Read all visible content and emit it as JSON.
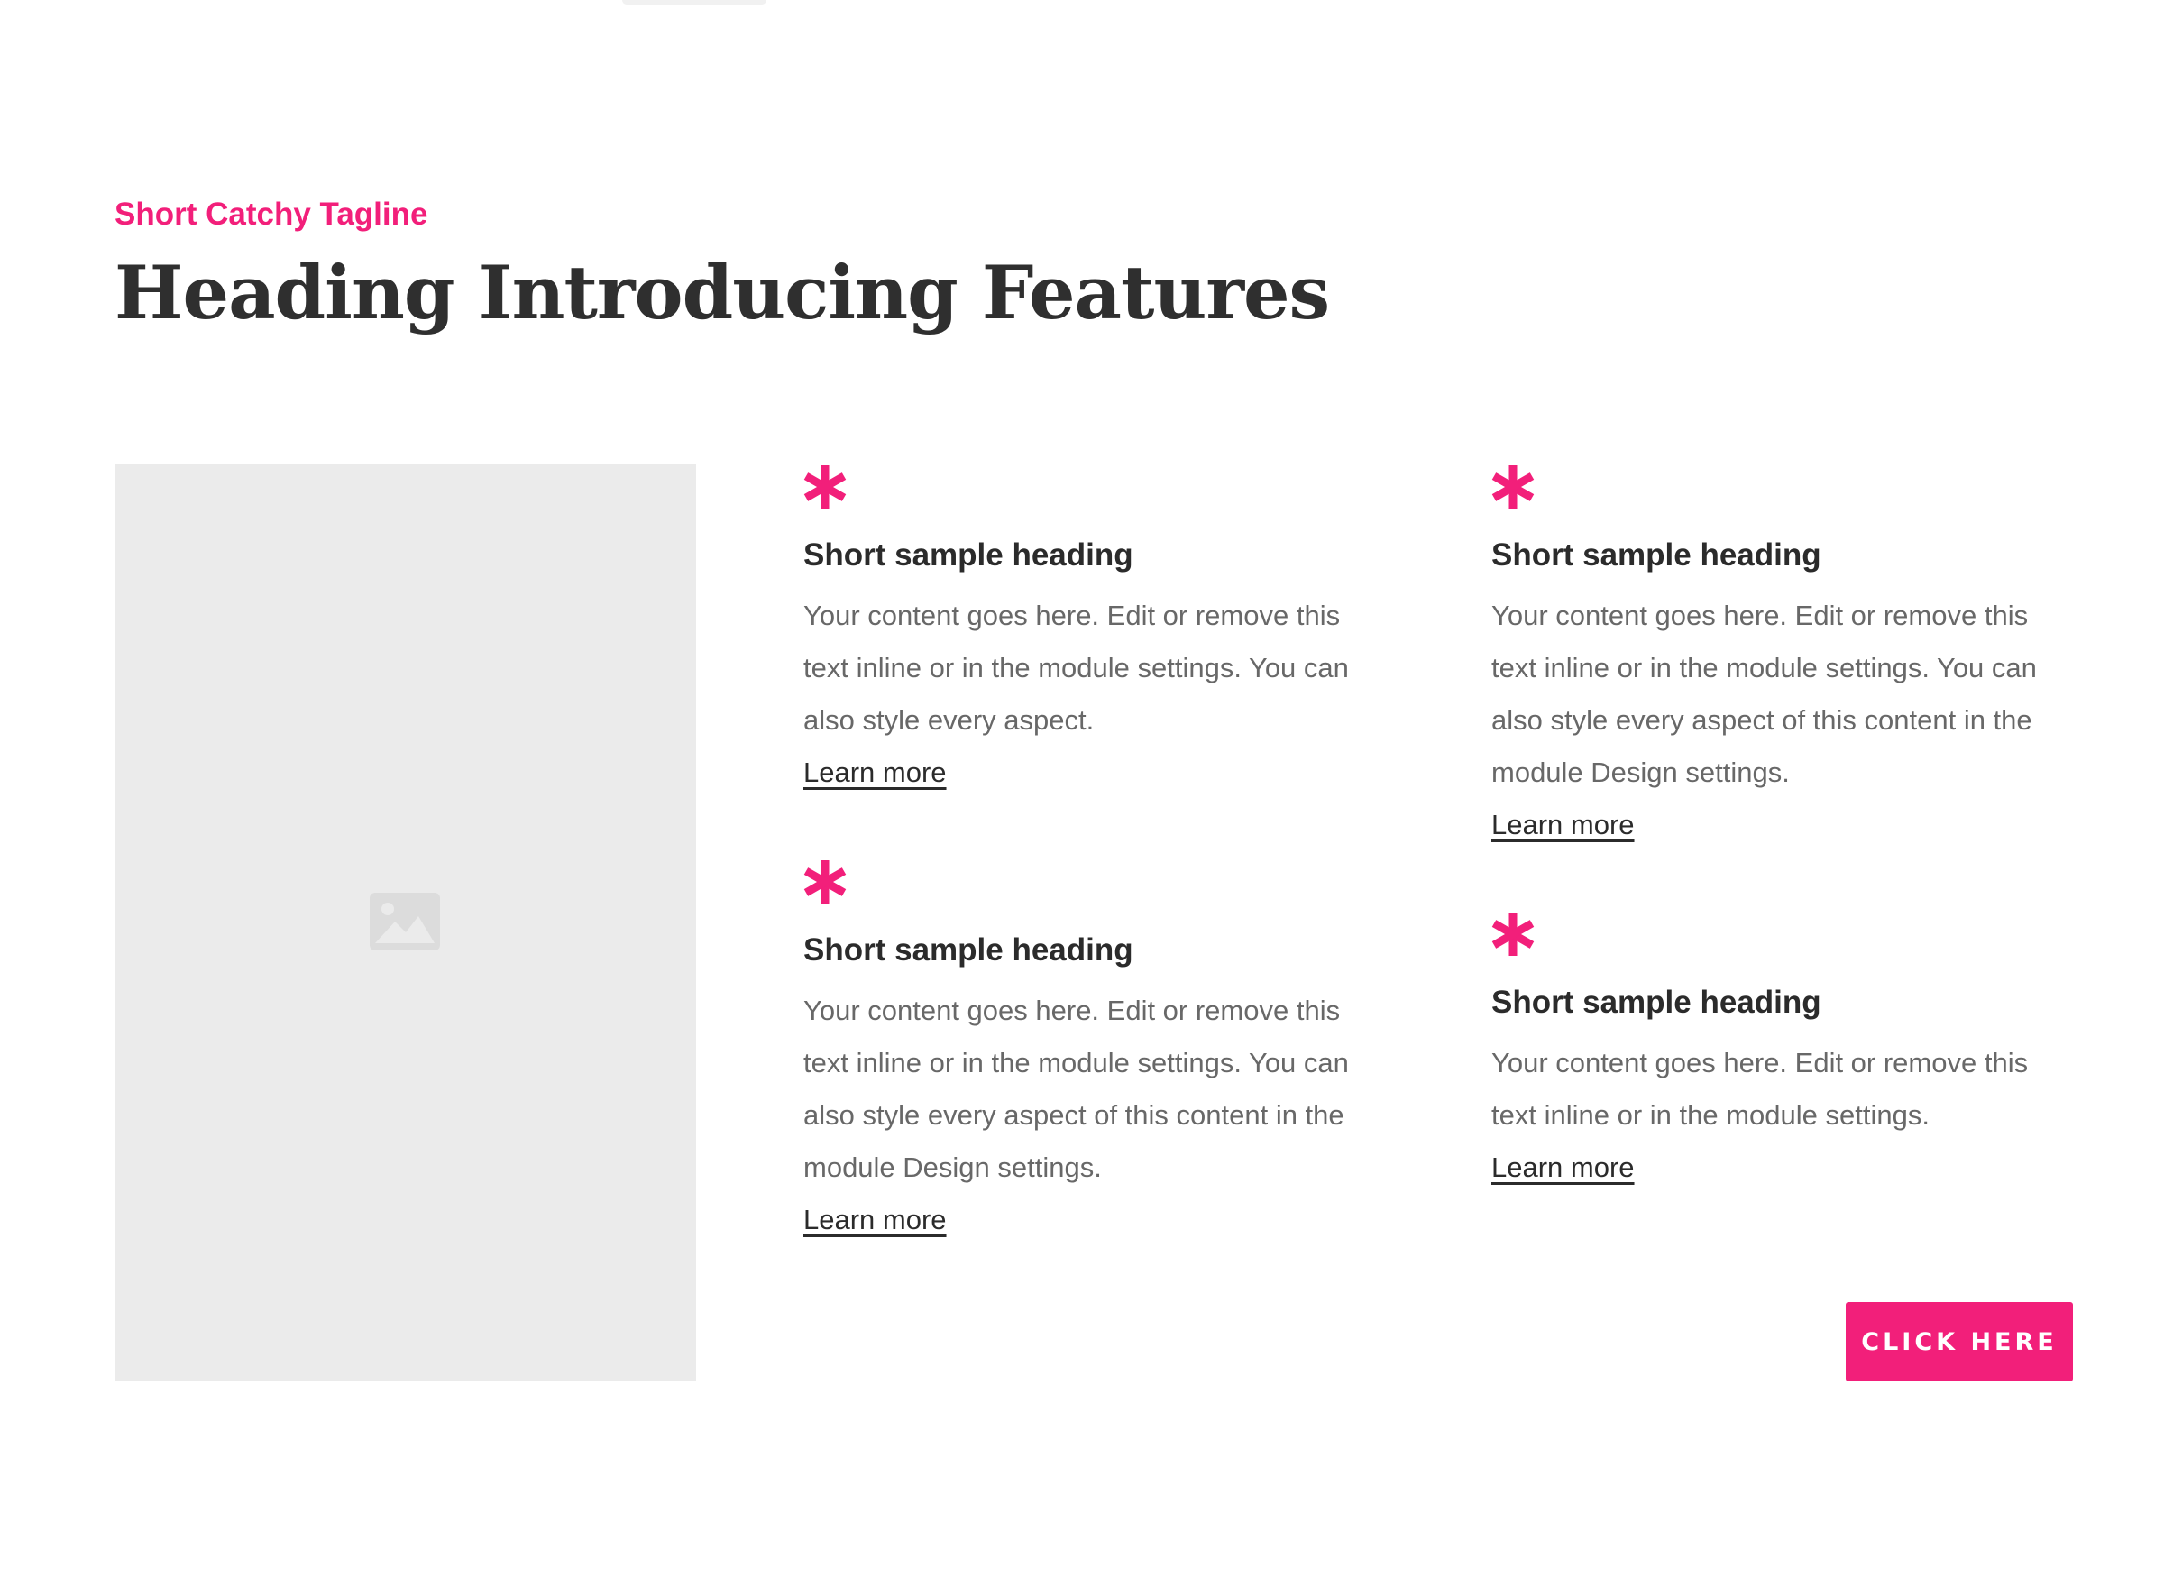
{
  "header": {
    "tagline": "Short Catchy Tagline",
    "title": "Heading Introducing Features"
  },
  "image": {
    "icon": "image-icon"
  },
  "features": [
    {
      "icon": "asterisk-icon",
      "heading": "Short sample heading",
      "body": "Your content goes here. Edit or remove this text inline or in the module settings. You can also style every aspect.",
      "link": "Learn more"
    },
    {
      "icon": "asterisk-icon",
      "heading": "Short sample heading",
      "body": "Your content goes here. Edit or remove this text inline or in the module settings. You can also style every aspect of this content in the module Design settings.",
      "link": "Learn more"
    },
    {
      "icon": "asterisk-icon",
      "heading": "Short sample heading",
      "body": "Your content goes here. Edit or remove this text inline or in the module settings. You can also style every aspect of this content in the module Design settings.",
      "link": "Learn more"
    },
    {
      "icon": "asterisk-icon",
      "heading": "Short sample heading",
      "body": "Your content goes here. Edit or remove this text inline or in the module settings.",
      "link": "Learn more"
    }
  ],
  "cta": {
    "label": "CLICK HERE"
  },
  "colors": {
    "accent": "#f21f7a",
    "heading": "#2f2f2f",
    "body": "#686868",
    "placeholder": "#ebebeb"
  }
}
